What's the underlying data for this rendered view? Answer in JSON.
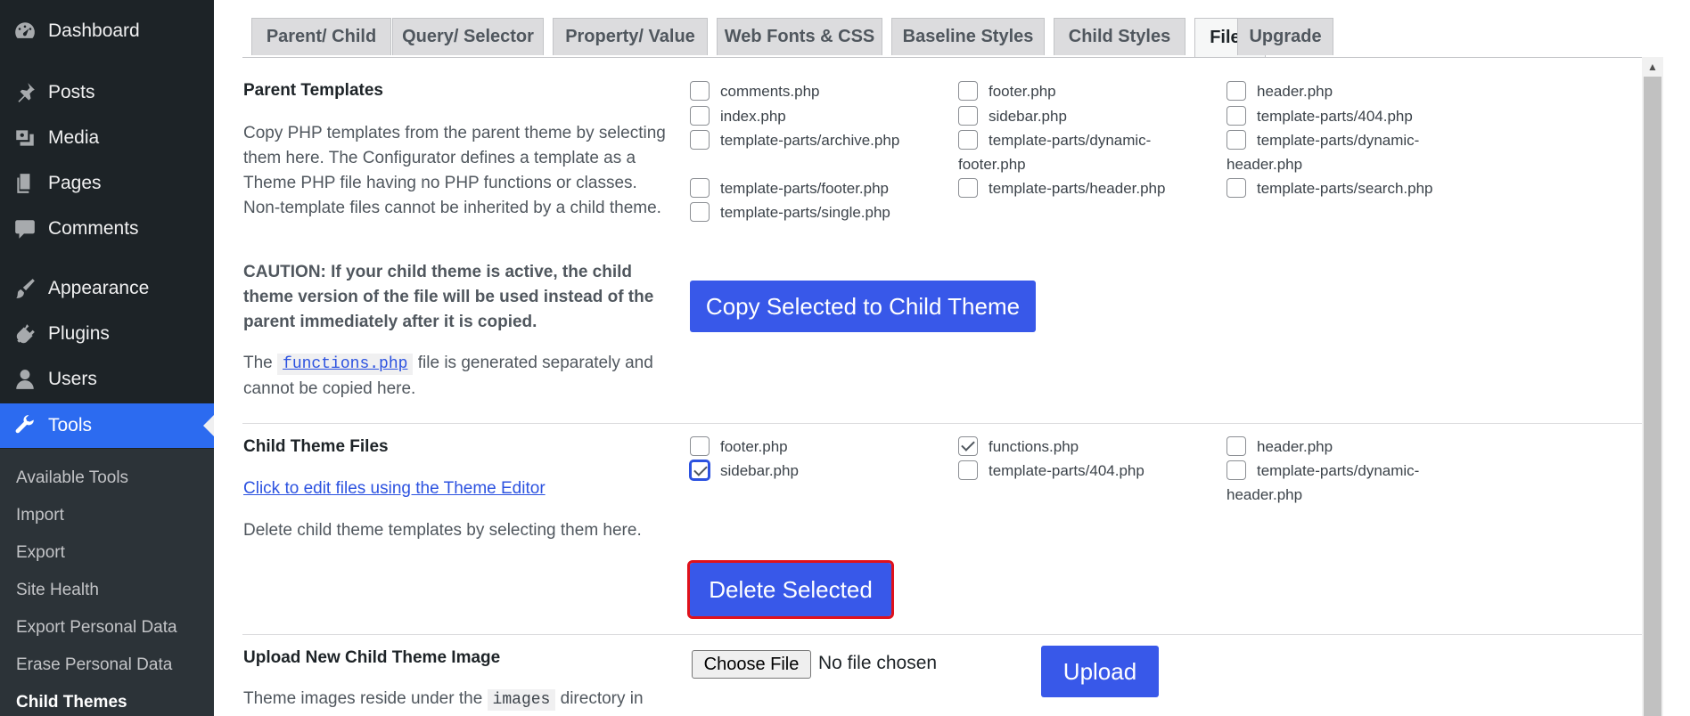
{
  "sidebar": {
    "items": [
      {
        "label": "Dashboard",
        "icon": "dashboard-icon"
      },
      {
        "label": "Posts",
        "icon": "pin-icon"
      },
      {
        "label": "Media",
        "icon": "media-icon"
      },
      {
        "label": "Pages",
        "icon": "pages-icon"
      },
      {
        "label": "Comments",
        "icon": "comments-icon"
      },
      {
        "label": "Appearance",
        "icon": "paintbrush-icon"
      },
      {
        "label": "Plugins",
        "icon": "plugin-icon"
      },
      {
        "label": "Users",
        "icon": "user-icon"
      },
      {
        "label": "Tools",
        "icon": "wrench-icon"
      }
    ],
    "submenu": [
      "Available Tools",
      "Import",
      "Export",
      "Site Health",
      "Export Personal Data",
      "Erase Personal Data",
      "Child Themes"
    ]
  },
  "tabs": [
    "Parent/ Child",
    "Query/ Selector",
    "Property/ Value",
    "Web Fonts & CSS",
    "Baseline Styles",
    "Child Styles",
    "Files",
    "Upgrade"
  ],
  "parent": {
    "title": "Parent Templates",
    "desc": "Copy PHP templates from the parent theme by selecting them here. The Configurator defines a template as a Theme PHP file having no PHP functions or classes. Non-template files cannot be inherited by a child theme.",
    "caution": "CAUTION: If your child theme is active, the child theme version of the file will be used instead of the parent immediately after it is copied.",
    "fn_pre": "The",
    "fn_code": "functions.php",
    "fn_post": "file is generated separately and cannot be copied here.",
    "files": [
      "comments.php",
      "footer.php",
      "header.php",
      "index.php",
      "sidebar.php",
      "template-parts/404.php",
      "template-parts/archive.php",
      "template-parts/dynamic-footer.php",
      "template-parts/dynamic-header.php",
      "template-parts/footer.php",
      "template-parts/header.php",
      "template-parts/search.php",
      "template-parts/single.php"
    ],
    "copy_button": "Copy Selected to Child Theme"
  },
  "child": {
    "title": "Child Theme Files",
    "edit_link": "Click to edit files using the Theme Editor",
    "desc": "Delete child theme templates by selecting them here.",
    "files": [
      "footer.php",
      "functions.php",
      "header.php",
      "sidebar.php",
      "template-parts/404.php",
      "template-parts/dynamic-header.php"
    ],
    "delete_button": "Delete Selected"
  },
  "upload": {
    "title": "Upload New Child Theme Image",
    "choose_label": "Choose File",
    "no_file": "No file chosen",
    "upload_button": "Upload",
    "desc_pre": "Theme images reside under the",
    "desc_code": "images",
    "desc_post": "directory in"
  }
}
